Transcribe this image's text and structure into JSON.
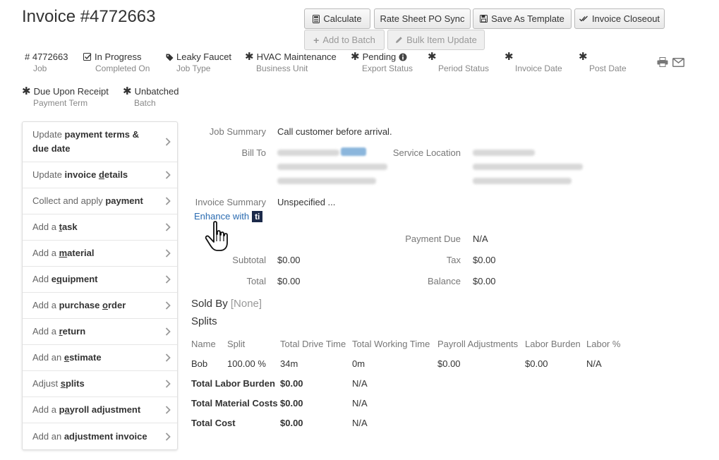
{
  "header": {
    "title": "Invoice #4772663"
  },
  "toolbar": {
    "calculate": "Calculate",
    "rate_sheet": "Rate Sheet PO Sync",
    "save_template": "Save As Template",
    "closeout": "Invoice Closeout",
    "add_batch": "Add to Batch",
    "bulk_update": "Bulk Item Update"
  },
  "meta": {
    "job": {
      "value": "# 4772663",
      "label": "Job"
    },
    "completed": {
      "value": "In Progress",
      "label": "Completed On"
    },
    "job_type": {
      "value": "Leaky Faucet",
      "label": "Job Type"
    },
    "business_unit": {
      "value": "HVAC Maintenance",
      "label": "Business Unit"
    },
    "export_status": {
      "value": "Pending",
      "label": "Export Status"
    },
    "period_status": {
      "label": "Period Status"
    },
    "invoice_date": {
      "label": "Invoice Date"
    },
    "post_date": {
      "label": "Post Date"
    },
    "payment_term": {
      "value": "Due Upon Receipt",
      "label": "Payment Term"
    },
    "batch": {
      "value": "Unbatched",
      "label": "Batch"
    },
    "required_mark": "✱"
  },
  "sidebar": {
    "items": [
      {
        "pre": "Update ",
        "bold": "payment terms & due date"
      },
      {
        "pre": "Update ",
        "bold": "invoice details"
      },
      {
        "pre": "Collect and apply ",
        "bold": "payment"
      },
      {
        "pre": "Add a ",
        "bold": "task"
      },
      {
        "pre": "Add a ",
        "bold": "material"
      },
      {
        "pre": "Add ",
        "bold": "equipment"
      },
      {
        "pre": "Add a ",
        "bold": "purchase order"
      },
      {
        "pre": "Add a ",
        "bold": "return"
      },
      {
        "pre": "Add an ",
        "bold": "estimate"
      },
      {
        "pre": "Adjust ",
        "bold": "splits"
      },
      {
        "pre": "Add a ",
        "bold": "payroll adjustment"
      },
      {
        "pre": "Add an ",
        "bold": "adjustment invoice"
      }
    ]
  },
  "details": {
    "job_summary_label": "Job Summary",
    "job_summary_value": "Call customer before arrival.",
    "bill_to_label": "Bill To",
    "service_location_label": "Service Location",
    "invoice_summary_label": "Invoice Summary",
    "invoice_summary_value": "Unspecified ...",
    "enhance_text": "Enhance with",
    "enhance_badge": "ti",
    "payment_due_label": "Payment Due",
    "payment_due_value": "N/A",
    "subtotal_label": "Subtotal",
    "subtotal_value": "$0.00",
    "tax_label": "Tax",
    "tax_value": "$0.00",
    "total_label": "Total",
    "total_value": "$0.00",
    "balance_label": "Balance",
    "balance_value": "$0.00"
  },
  "sold_by": {
    "label": "Sold By",
    "value": "[None]"
  },
  "splits": {
    "title": "Splits",
    "headers": [
      "Name",
      "Split",
      "Total Drive Time",
      "Total Working Time",
      "Payroll Adjustments",
      "Labor Burden",
      "Labor %"
    ],
    "row": [
      "Bob",
      "100.00 %",
      "34m",
      "0m",
      "$0.00",
      "$0.00",
      "N/A"
    ],
    "totals": [
      {
        "label": "Total Labor Burden",
        "value": "$0.00",
        "extra": "N/A"
      },
      {
        "label": "Total Material Costs",
        "value": "$0.00",
        "extra": "N/A"
      },
      {
        "label": "Total Cost",
        "value": "$0.00",
        "extra": "N/A"
      }
    ]
  }
}
